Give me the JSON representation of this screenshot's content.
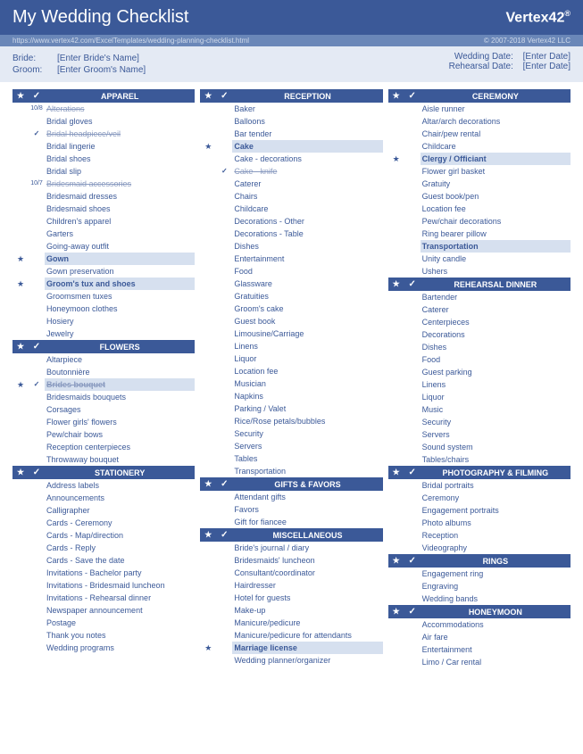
{
  "header": {
    "title": "My Wedding Checklist",
    "logo": "Vertex42"
  },
  "urlbar": {
    "url": "https://www.vertex42.com/ExcelTemplates/wedding-planning-checklist.html",
    "copyright": "© 2007-2018 Vertex42 LLC"
  },
  "info": {
    "bride_label": "Bride:",
    "bride_value": "[Enter Bride's Name]",
    "groom_label": "Groom:",
    "groom_value": "[Enter Groom's Name]",
    "wedding_label": "Wedding Date:",
    "wedding_value": "[Enter Date]",
    "rehearsal_label": "Rehearsal Date:",
    "rehearsal_value": "[Enter Date]"
  },
  "columns": [
    [
      {
        "title": "APPAREL",
        "items": [
          {
            "t": "Alterations",
            "date": "10/8",
            "done": true
          },
          {
            "t": "Bridal gloves"
          },
          {
            "t": "Bridal headpiece/veil",
            "check": true,
            "done": true
          },
          {
            "t": "Bridal lingerie"
          },
          {
            "t": "Bridal shoes"
          },
          {
            "t": "Bridal slip"
          },
          {
            "t": "Bridesmaid accessories",
            "date": "10/7",
            "done": true
          },
          {
            "t": "Bridesmaid dresses"
          },
          {
            "t": "Bridesmaid shoes"
          },
          {
            "t": "Children's apparel"
          },
          {
            "t": "Garters"
          },
          {
            "t": "Going-away outfit"
          },
          {
            "t": "Gown",
            "star": true,
            "hl": true
          },
          {
            "t": "Gown preservation"
          },
          {
            "t": "Groom's tux and shoes",
            "star": true,
            "hl": true
          },
          {
            "t": "Groomsmen tuxes"
          },
          {
            "t": "Honeymoon clothes"
          },
          {
            "t": "Hosiery"
          },
          {
            "t": "Jewelry"
          }
        ]
      },
      {
        "title": "FLOWERS",
        "items": [
          {
            "t": "Altarpiece"
          },
          {
            "t": "Boutonnière"
          },
          {
            "t": "Brides bouquet",
            "star": true,
            "check": true,
            "done": true,
            "hl": true
          },
          {
            "t": "Bridesmaids bouquets"
          },
          {
            "t": "Corsages"
          },
          {
            "t": "Flower girls' flowers"
          },
          {
            "t": "Pew/chair bows"
          },
          {
            "t": "Reception centerpieces"
          },
          {
            "t": "Throwaway bouquet"
          }
        ]
      },
      {
        "title": "STATIONERY",
        "items": [
          {
            "t": "Address labels"
          },
          {
            "t": "Announcements"
          },
          {
            "t": "Calligrapher"
          },
          {
            "t": "Cards - Ceremony"
          },
          {
            "t": "Cards - Map/direction"
          },
          {
            "t": "Cards - Reply"
          },
          {
            "t": "Cards - Save the date"
          },
          {
            "t": "Invitations - Bachelor party"
          },
          {
            "t": "Invitations - Bridesmaid luncheon"
          },
          {
            "t": "Invitations - Rehearsal dinner"
          },
          {
            "t": "Newspaper announcement"
          },
          {
            "t": "Postage"
          },
          {
            "t": "Thank you notes"
          },
          {
            "t": "Wedding programs"
          }
        ]
      }
    ],
    [
      {
        "title": "RECEPTION",
        "items": [
          {
            "t": "Baker"
          },
          {
            "t": "Balloons"
          },
          {
            "t": "Bar tender"
          },
          {
            "t": "Cake",
            "star": true,
            "hl": true
          },
          {
            "t": "Cake - decorations"
          },
          {
            "t": "Cake - knife",
            "check": true,
            "done": true
          },
          {
            "t": "Caterer"
          },
          {
            "t": "Chairs"
          },
          {
            "t": "Childcare"
          },
          {
            "t": "Decorations - Other"
          },
          {
            "t": "Decorations - Table"
          },
          {
            "t": "Dishes"
          },
          {
            "t": "Entertainment"
          },
          {
            "t": "Food"
          },
          {
            "t": "Glassware"
          },
          {
            "t": "Gratuities"
          },
          {
            "t": "Groom's cake"
          },
          {
            "t": "Guest book"
          },
          {
            "t": "Limousine/Carriage"
          },
          {
            "t": "Linens"
          },
          {
            "t": "Liquor"
          },
          {
            "t": "Location fee"
          },
          {
            "t": "Musician"
          },
          {
            "t": "Napkins"
          },
          {
            "t": "Parking / Valet"
          },
          {
            "t": "Rice/Rose petals/bubbles"
          },
          {
            "t": "Security"
          },
          {
            "t": "Servers"
          },
          {
            "t": "Tables"
          },
          {
            "t": "Transportation"
          }
        ]
      },
      {
        "title": "GIFTS & FAVORS",
        "items": [
          {
            "t": "Attendant gifts"
          },
          {
            "t": "Favors"
          },
          {
            "t": "Gift for fiancee"
          }
        ]
      },
      {
        "title": "MISCELLANEOUS",
        "items": [
          {
            "t": "Bride's journal / diary"
          },
          {
            "t": "Bridesmaids' luncheon"
          },
          {
            "t": "Consultant/coordinator"
          },
          {
            "t": "Hairdresser"
          },
          {
            "t": "Hotel for guests"
          },
          {
            "t": "Make-up"
          },
          {
            "t": "Manicure/pedicure"
          },
          {
            "t": "Manicure/pedicure for attendants"
          },
          {
            "t": "Marriage license",
            "star": true,
            "hl": true
          },
          {
            "t": "Wedding planner/organizer"
          }
        ]
      }
    ],
    [
      {
        "title": "CEREMONY",
        "items": [
          {
            "t": "Aisle runner"
          },
          {
            "t": "Altar/arch decorations"
          },
          {
            "t": "Chair/pew rental"
          },
          {
            "t": "Childcare"
          },
          {
            "t": "Clergy / Officiant",
            "star": true,
            "hl": true
          },
          {
            "t": "Flower girl basket"
          },
          {
            "t": "Gratuity"
          },
          {
            "t": "Guest book/pen"
          },
          {
            "t": "Location fee"
          },
          {
            "t": "Pew/chair decorations"
          },
          {
            "t": "Ring bearer pillow"
          },
          {
            "t": "Transportation",
            "hl": true
          },
          {
            "t": "Unity candle"
          },
          {
            "t": "Ushers"
          }
        ]
      },
      {
        "title": "REHEARSAL DINNER",
        "items": [
          {
            "t": "Bartender"
          },
          {
            "t": "Caterer"
          },
          {
            "t": "Centerpieces"
          },
          {
            "t": "Decorations"
          },
          {
            "t": "Dishes"
          },
          {
            "t": "Food"
          },
          {
            "t": "Guest parking"
          },
          {
            "t": "Linens"
          },
          {
            "t": "Liquor"
          },
          {
            "t": "Music"
          },
          {
            "t": "Security"
          },
          {
            "t": "Servers"
          },
          {
            "t": "Sound system"
          },
          {
            "t": "Tables/chairs"
          }
        ]
      },
      {
        "title": "PHOTOGRAPHY & FILMING",
        "items": [
          {
            "t": "Bridal portraits"
          },
          {
            "t": "Ceremony"
          },
          {
            "t": "Engagement portraits"
          },
          {
            "t": "Photo albums"
          },
          {
            "t": "Reception"
          },
          {
            "t": "Videography"
          }
        ]
      },
      {
        "title": "RINGS",
        "items": [
          {
            "t": "Engagement ring"
          },
          {
            "t": "Engraving"
          },
          {
            "t": "Wedding bands"
          }
        ]
      },
      {
        "title": "HONEYMOON",
        "items": [
          {
            "t": "Accommodations"
          },
          {
            "t": "Air fare"
          },
          {
            "t": "Entertainment"
          },
          {
            "t": "Limo / Car rental"
          }
        ]
      }
    ]
  ]
}
